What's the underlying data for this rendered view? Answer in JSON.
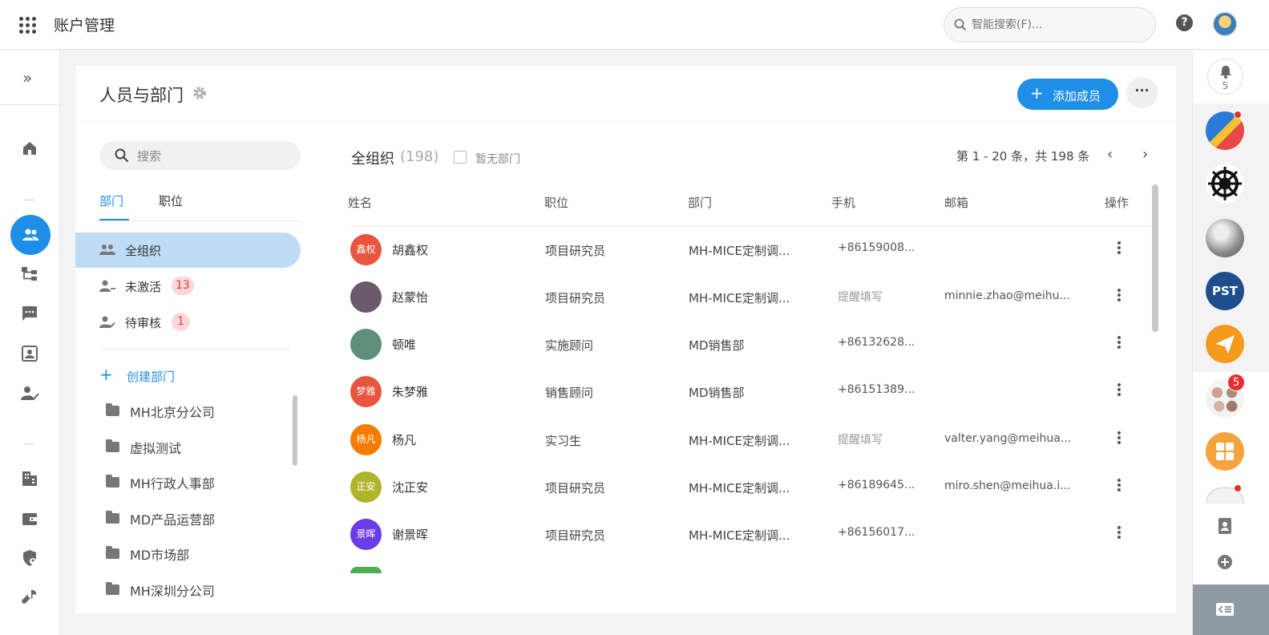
{
  "app": {
    "title": "账户管理"
  },
  "search": {
    "placeholder": "智能搜索(F)..."
  },
  "rail": {
    "notifications": "5",
    "group_badge": "5"
  },
  "page": {
    "title": "人员与部门",
    "add_label": "添加成员",
    "more_label": "···"
  },
  "dept_panel": {
    "search_placeholder": "搜索",
    "tabs": [
      "部门",
      "职位"
    ],
    "org_items": [
      {
        "label": "全组织",
        "badge": ""
      },
      {
        "label": "未激活",
        "badge": "13"
      },
      {
        "label": "待审核",
        "badge": "1"
      }
    ],
    "create_label": "创建部门",
    "departments": [
      "MH北京分公司",
      "虚拟测试",
      "MH行政人事部",
      "MD产品运营部",
      "MD市场部",
      "MH深圳分公司"
    ]
  },
  "list": {
    "title": "全组织",
    "count": "(198)",
    "no_dept_label": "暂无部门",
    "pager_text": "第 1 - 20 条，共 198 条",
    "headers": [
      "姓名",
      "职位",
      "部门",
      "手机",
      "邮箱",
      "操作"
    ],
    "rows": [
      {
        "avatar_text": "鑫权",
        "avatar_color": "#e8553e",
        "name": "胡鑫权",
        "position": "项目研究员",
        "department": "MH-MICE定制调...",
        "phone": "+86159008...",
        "email": ""
      },
      {
        "avatar_text": "",
        "avatar_color": "#6b5a6e",
        "name": "赵蒙怡",
        "position": "项目研究员",
        "department": "MH-MICE定制调...",
        "phone": "提醒填写",
        "email": "minnie.zhao@meihu..."
      },
      {
        "avatar_text": "",
        "avatar_color": "#5e8f7a",
        "name": "顿唯",
        "position": "实施顾问",
        "department": "MD销售部",
        "phone": "+86132628...",
        "email": ""
      },
      {
        "avatar_text": "梦雅",
        "avatar_color": "#e8553e",
        "name": "朱梦雅",
        "position": "销售顾问",
        "department": "MD销售部",
        "phone": "+86151389...",
        "email": ""
      },
      {
        "avatar_text": "杨凡",
        "avatar_color": "#f57c00",
        "name": "杨凡",
        "position": "实习生",
        "department": "MH-MICE定制调...",
        "phone": "提醒填写",
        "email": "valter.yang@meihua..."
      },
      {
        "avatar_text": "正安",
        "avatar_color": "#afb42b",
        "name": "沈正安",
        "position": "项目研究员",
        "department": "MH-MICE定制调...",
        "phone": "+86189645...",
        "email": "miro.shen@meihua.i..."
      },
      {
        "avatar_text": "景晖",
        "avatar_color": "#6a3de8",
        "name": "谢景晖",
        "position": "项目研究员",
        "department": "MH-MICE定制调...",
        "phone": "+86156017...",
        "email": ""
      }
    ]
  }
}
